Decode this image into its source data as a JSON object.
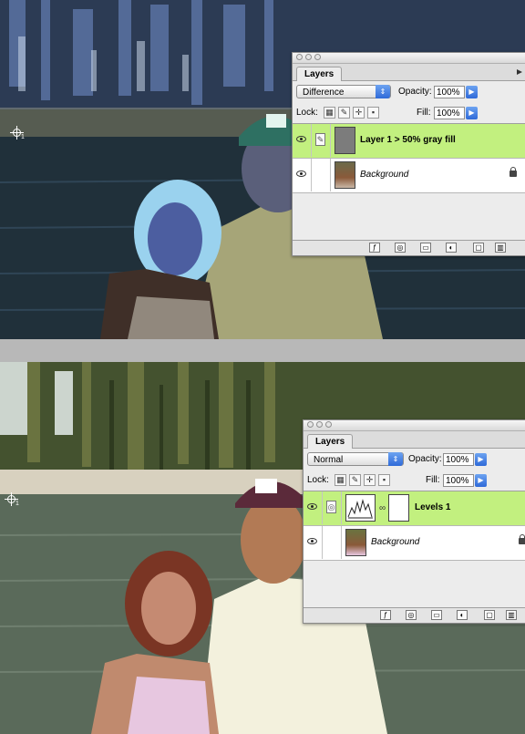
{
  "top_panel": {
    "tab": "Layers",
    "blend_mode": "Difference",
    "opacity_label": "Opacity:",
    "opacity_value": "100%",
    "lock_label": "Lock:",
    "fill_label": "Fill:",
    "fill_value": "100%",
    "layers": [
      {
        "name": "Layer 1 > 50% gray fill",
        "selected": true,
        "visible": true
      },
      {
        "name": "Background",
        "selected": false,
        "visible": true,
        "locked": true
      }
    ]
  },
  "bottom_panel": {
    "tab": "Layers",
    "blend_mode": "Normal",
    "opacity_label": "Opacity:",
    "opacity_value": "100%",
    "lock_label": "Lock:",
    "fill_label": "Fill:",
    "fill_value": "100%",
    "layers": [
      {
        "name": "Levels 1",
        "selected": true,
        "visible": true
      },
      {
        "name": "Background",
        "selected": false,
        "visible": true,
        "locked": true
      }
    ]
  },
  "cursor_subscript": "1",
  "colors": {
    "selected_layer": "#c2f07f",
    "panel_bg": "#ececec",
    "top_photo_tint": "#1d2a2a",
    "bottom_photo_tint": "#3e4a43"
  },
  "icons": [
    "eye-icon",
    "brush-icon",
    "move-icon",
    "lock-icon",
    "chain-icon",
    "layer-style-icon",
    "mask-icon",
    "folder-icon",
    "adjustment-icon",
    "new-layer-icon",
    "trash-icon"
  ]
}
